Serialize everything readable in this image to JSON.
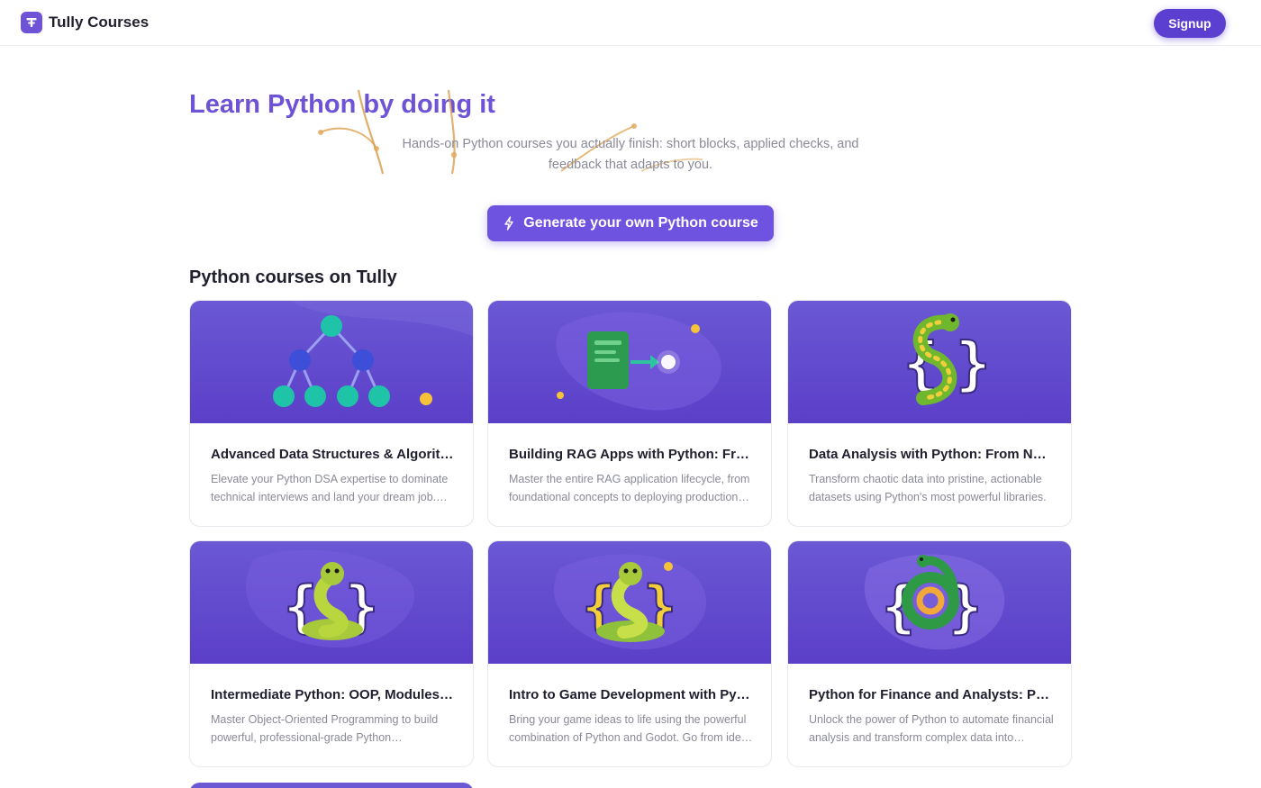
{
  "header": {
    "brand": "Tully Courses",
    "logo_icon": "tully-logo-icon",
    "signup_label": "Signup"
  },
  "hero": {
    "title": "Learn Python by doing it",
    "subtitle": "Hands-on Python courses you actually finish: short blocks, applied checks, and feedback that adapts to you.",
    "cta_label": "Generate your own Python course",
    "cta_icon": "lightning-icon"
  },
  "section": {
    "title": "Python courses on Tully"
  },
  "courses": [
    {
      "title": "Advanced Data Structures & Algorithms",
      "description": "Elevate your Python DSA expertise to dominate technical interviews and land your dream job. Master every pattern.",
      "image_icon": "tree-graph-icon"
    },
    {
      "title": "Building RAG Apps with Python: From Zero to Production",
      "description": "Master the entire RAG application lifecycle, from foundational concepts to deploying production systems.",
      "image_icon": "document-arrow-icon"
    },
    {
      "title": "Data Analysis with Python: From NumPy to Pandas",
      "description": "Transform chaotic data into pristine, actionable datasets using Python's most powerful libraries.",
      "image_icon": "python-braces-icon"
    },
    {
      "title": "Intermediate Python: OOP, Modules, and More",
      "description": "Master Object-Oriented Programming to build powerful, professional-grade Python applications.",
      "image_icon": "python-snake-icon"
    },
    {
      "title": "Intro to Game Development with Python and Godot",
      "description": "Bring your game ideas to life using the powerful combination of Python and Godot. Go from idea to game.",
      "image_icon": "python-snake-icon"
    },
    {
      "title": "Python for Finance and Analysts: Practical Automation",
      "description": "Unlock the power of Python to automate financial analysis and transform complex data into insights.",
      "image_icon": "python-spiral-icon"
    }
  ],
  "colors": {
    "accent": "#6e53d6",
    "button": "#5b3fd0",
    "card_image": "#5b3fc8"
  }
}
